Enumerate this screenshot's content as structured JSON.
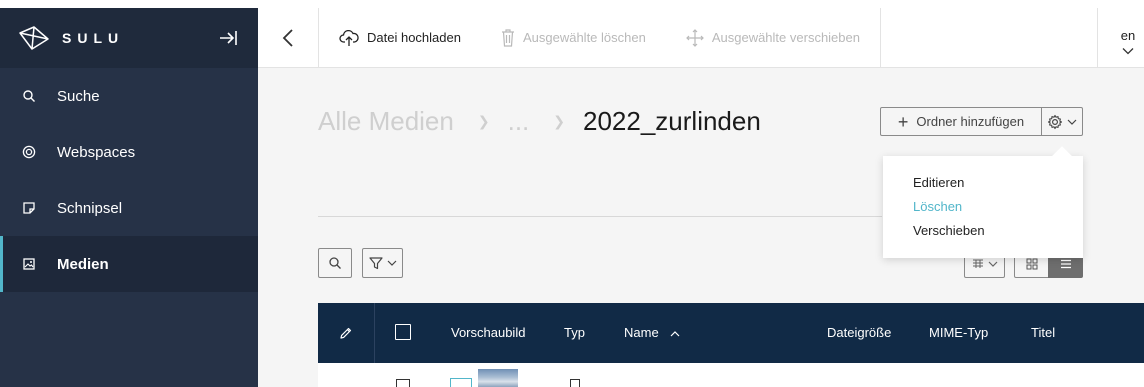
{
  "app": {
    "logo_text": "SULU"
  },
  "sidebar": {
    "items": [
      {
        "label": "Suche",
        "icon": "search-icon"
      },
      {
        "label": "Webspaces",
        "icon": "target-icon"
      },
      {
        "label": "Schnipsel",
        "icon": "snippet-icon"
      },
      {
        "label": "Medien",
        "icon": "image-icon",
        "active": true
      }
    ]
  },
  "toolbar": {
    "upload_label": "Datei hochladen",
    "delete_label": "Ausgewählte löschen",
    "move_label": "Ausgewählte verschieben",
    "locale": "en"
  },
  "breadcrumb": {
    "root": "Alle Medien",
    "ellipsis": "...",
    "current": "2022_zurlinden"
  },
  "actions": {
    "add_folder_label": "Ordner hinzufügen"
  },
  "folder_menu": {
    "items": [
      "Editieren",
      "Löschen",
      "Verschieben"
    ],
    "highlighted_index": 1
  },
  "table": {
    "columns": [
      "Vorschaubild",
      "Typ",
      "Name",
      "Dateigröße",
      "MIME-Typ",
      "Titel"
    ],
    "sort_column": "Name",
    "sort_direction": "asc"
  },
  "colors": {
    "sidebar_bg": "#263247",
    "accent": "#52b6ca",
    "table_header_bg": "#112a46"
  }
}
